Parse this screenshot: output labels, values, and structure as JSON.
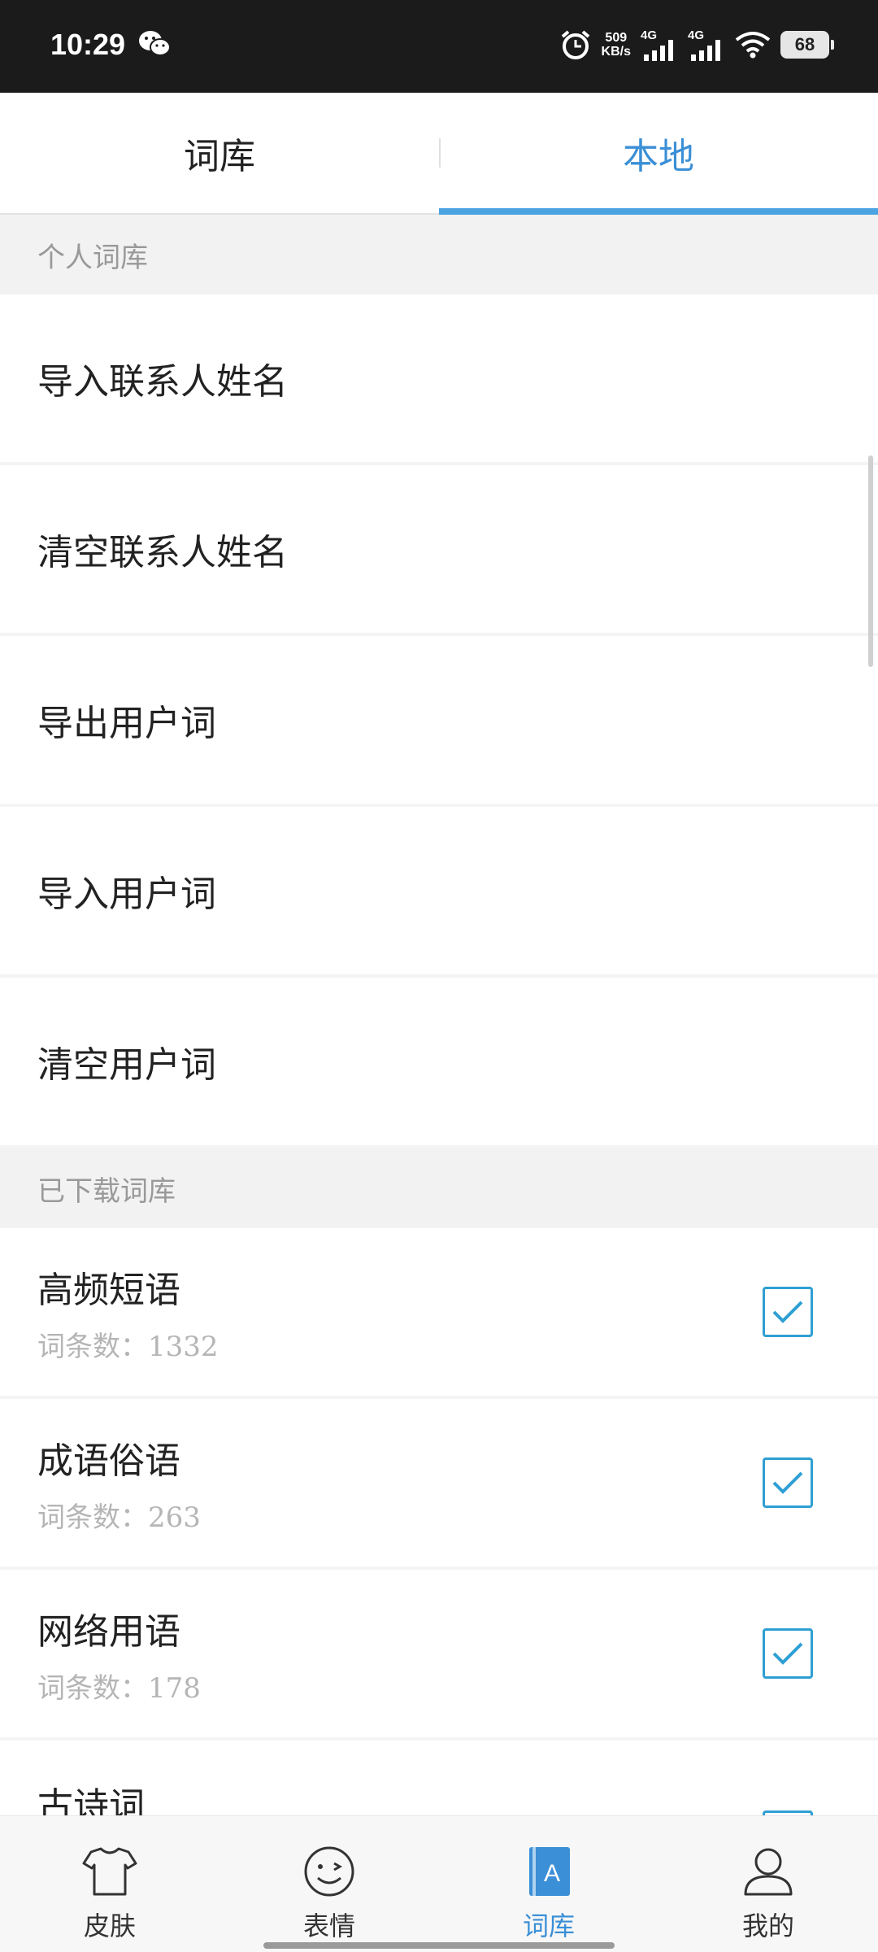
{
  "status_bar": {
    "time": "10:29",
    "net_speed_value": "509",
    "net_speed_unit": "KB/s",
    "signal1_label": "4G",
    "signal2_label": "4G",
    "battery": "68",
    "icons": [
      "wechat-icon",
      "alarm-icon",
      "signal-icon",
      "wifi-icon",
      "battery-icon"
    ]
  },
  "tabs": [
    {
      "label": "词库",
      "active": false
    },
    {
      "label": "本地",
      "active": true
    }
  ],
  "sections": {
    "personal": {
      "header": "个人词库",
      "items": [
        "导入联系人姓名",
        "清空联系人姓名",
        "导出用户词",
        "导入用户词",
        "清空用户词"
      ]
    },
    "downloaded": {
      "header": "已下载词库",
      "items": [
        {
          "name": "高频短语",
          "count_label": "词条数：",
          "count": "1332",
          "checked": true
        },
        {
          "name": "成语俗语",
          "count_label": "词条数：",
          "count": "263",
          "checked": true
        },
        {
          "name": "网络用语",
          "count_label": "词条数：",
          "count": "178",
          "checked": true
        },
        {
          "name": "古诗词",
          "count_label": "",
          "count": "",
          "checked": true
        }
      ]
    }
  },
  "bottom_nav": [
    {
      "label": "皮肤",
      "icon": "shirt-icon",
      "active": false
    },
    {
      "label": "表情",
      "icon": "smiley-icon",
      "active": false
    },
    {
      "label": "词库",
      "icon": "dictionary-icon",
      "active": true
    },
    {
      "label": "我的",
      "icon": "user-icon",
      "active": false
    }
  ],
  "colors": {
    "accent": "#3b8fd6",
    "checkbox": "#2f9fd3",
    "status_bar": "#1b1b1b"
  }
}
